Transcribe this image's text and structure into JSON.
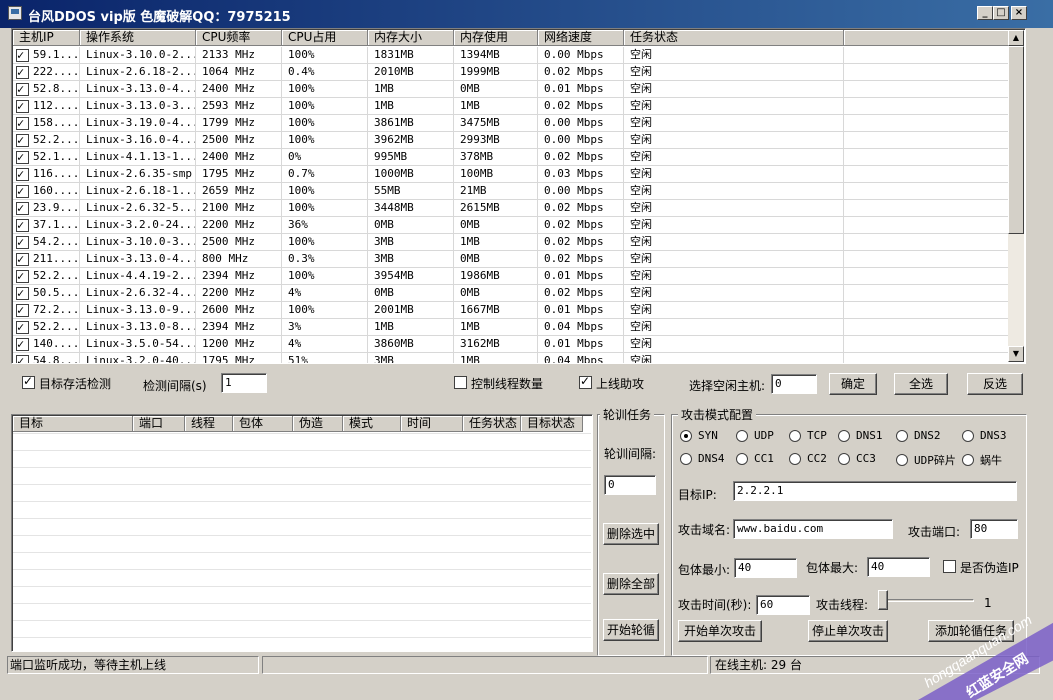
{
  "window": {
    "title": "台风DDOS vip版    色魔破解QQ：7975215",
    "minimize": "_",
    "maximize": "□",
    "close": "×"
  },
  "host_list": {
    "columns": [
      "主机IP",
      "操作系统",
      "CPU频率",
      "CPU占用",
      "内存大小",
      "内存使用",
      "网络速度",
      "任务状态"
    ],
    "rows": [
      [
        "59.1...",
        "Linux-3.10.0-2...",
        "2133 MHz",
        "100%",
        "1831MB",
        "1394MB",
        "0.00 Mbps",
        "空闲"
      ],
      [
        "222....",
        "Linux-2.6.18-2...",
        "1064 MHz",
        "0.4%",
        "2010MB",
        "1999MB",
        "0.02 Mbps",
        "空闲"
      ],
      [
        "52.8...",
        "Linux-3.13.0-4...",
        "2400 MHz",
        "100%",
        "1MB",
        "0MB",
        "0.01 Mbps",
        "空闲"
      ],
      [
        "112....",
        "Linux-3.13.0-3...",
        "2593 MHz",
        "100%",
        "1MB",
        "1MB",
        "0.02 Mbps",
        "空闲"
      ],
      [
        "158....",
        "Linux-3.19.0-4...",
        "1799 MHz",
        "100%",
        "3861MB",
        "3475MB",
        "0.00 Mbps",
        "空闲"
      ],
      [
        "52.2...",
        "Linux-3.16.0-4...",
        "2500 MHz",
        "100%",
        "3962MB",
        "2993MB",
        "0.00 Mbps",
        "空闲"
      ],
      [
        "52.1...",
        "Linux-4.1.13-1...",
        "2400 MHz",
        "0%",
        "995MB",
        "378MB",
        "0.02 Mbps",
        "空闲"
      ],
      [
        "116....",
        "Linux-2.6.35-smp",
        "1795 MHz",
        "0.7%",
        "1000MB",
        "100MB",
        "0.03 Mbps",
        "空闲"
      ],
      [
        "160....",
        "Linux-2.6.18-1...",
        "2659 MHz",
        "100%",
        "55MB",
        "21MB",
        "0.00 Mbps",
        "空闲"
      ],
      [
        "23.9...",
        "Linux-2.6.32-5...",
        "2100 MHz",
        "100%",
        "3448MB",
        "2615MB",
        "0.02 Mbps",
        "空闲"
      ],
      [
        "37.1...",
        "Linux-3.2.0-24...",
        "2200 MHz",
        "36%",
        "0MB",
        "0MB",
        "0.02 Mbps",
        "空闲"
      ],
      [
        "54.2...",
        "Linux-3.10.0-3...",
        "2500 MHz",
        "100%",
        "3MB",
        "1MB",
        "0.02 Mbps",
        "空闲"
      ],
      [
        "211....",
        "Linux-3.13.0-4...",
        "800 MHz",
        "0.3%",
        "3MB",
        "0MB",
        "0.02 Mbps",
        "空闲"
      ],
      [
        "52.2...",
        "Linux-4.4.19-2...",
        "2394 MHz",
        "100%",
        "3954MB",
        "1986MB",
        "0.01 Mbps",
        "空闲"
      ],
      [
        "50.5...",
        "Linux-2.6.32-4...",
        "2200 MHz",
        "4%",
        "0MB",
        "0MB",
        "0.02 Mbps",
        "空闲"
      ],
      [
        "72.2...",
        "Linux-3.13.0-9...",
        "2600 MHz",
        "100%",
        "2001MB",
        "1667MB",
        "0.01 Mbps",
        "空闲"
      ],
      [
        "52.2...",
        "Linux-3.13.0-8...",
        "2394 MHz",
        "3%",
        "1MB",
        "1MB",
        "0.04 Mbps",
        "空闲"
      ],
      [
        "140....",
        "Linux-3.5.0-54...",
        "1200 MHz",
        "4%",
        "3860MB",
        "3162MB",
        "0.01 Mbps",
        "空闲"
      ],
      [
        "54.8...",
        "Linux-3.2.0-40...",
        "1795 MHz",
        "51%",
        "3MB",
        "1MB",
        "0.04 Mbps",
        "空闲"
      ]
    ]
  },
  "controls": {
    "alive_check_label": "目标存活检测",
    "check_interval_label": "检测间隔(s)",
    "check_interval_value": "1",
    "control_threads_label": "控制线程数量",
    "online_assist_label": "上线助攻",
    "select_idle_label": "选择空闲主机:",
    "select_idle_value": "0",
    "confirm_button": "确定",
    "select_all_button": "全选",
    "invert_button": "反选"
  },
  "task_list": {
    "columns": [
      "目标",
      "端口",
      "线程",
      "包体",
      "伪造",
      "模式",
      "时间",
      "任务状态",
      "目标状态"
    ]
  },
  "rotation": {
    "title": "轮训任务",
    "interval_label": "轮训间隔:",
    "interval_value": "0",
    "delete_selected": "删除选中",
    "delete_all": "删除全部",
    "start_rotation": "开始轮循"
  },
  "attack": {
    "title": "攻击模式配置",
    "modes": [
      "SYN",
      "UDP",
      "TCP",
      "DNS1",
      "DNS2",
      "DNS3",
      "DNS4",
      "CC1",
      "CC2",
      "CC3",
      "UDP碎片",
      "蜗牛"
    ],
    "selected_mode": "SYN",
    "target_ip_label": "目标IP:",
    "target_ip_value": "2.2.2.1",
    "domain_label": "攻击域名:",
    "domain_value": "www.baidu.com",
    "port_label": "攻击端口:",
    "port_value": "80",
    "min_packet_label": "包体最小:",
    "min_packet_value": "40",
    "max_packet_label": "包体最大:",
    "max_packet_value": "40",
    "spoof_ip_label": "是否伪造IP",
    "time_label": "攻击时间(秒):",
    "time_value": "60",
    "threads_label": "攻击线程:",
    "threads_value": "1",
    "start_single": "开始单次攻击",
    "stop_single": "停止单次攻击",
    "add_rotation": "添加轮循任务"
  },
  "status_bar": {
    "message": "端口监听成功，等待主机上线",
    "online": "在线主机: 29 台"
  },
  "watermark": {
    "line1": "hongqaanquan.com",
    "line2": "红蓝安全网"
  }
}
